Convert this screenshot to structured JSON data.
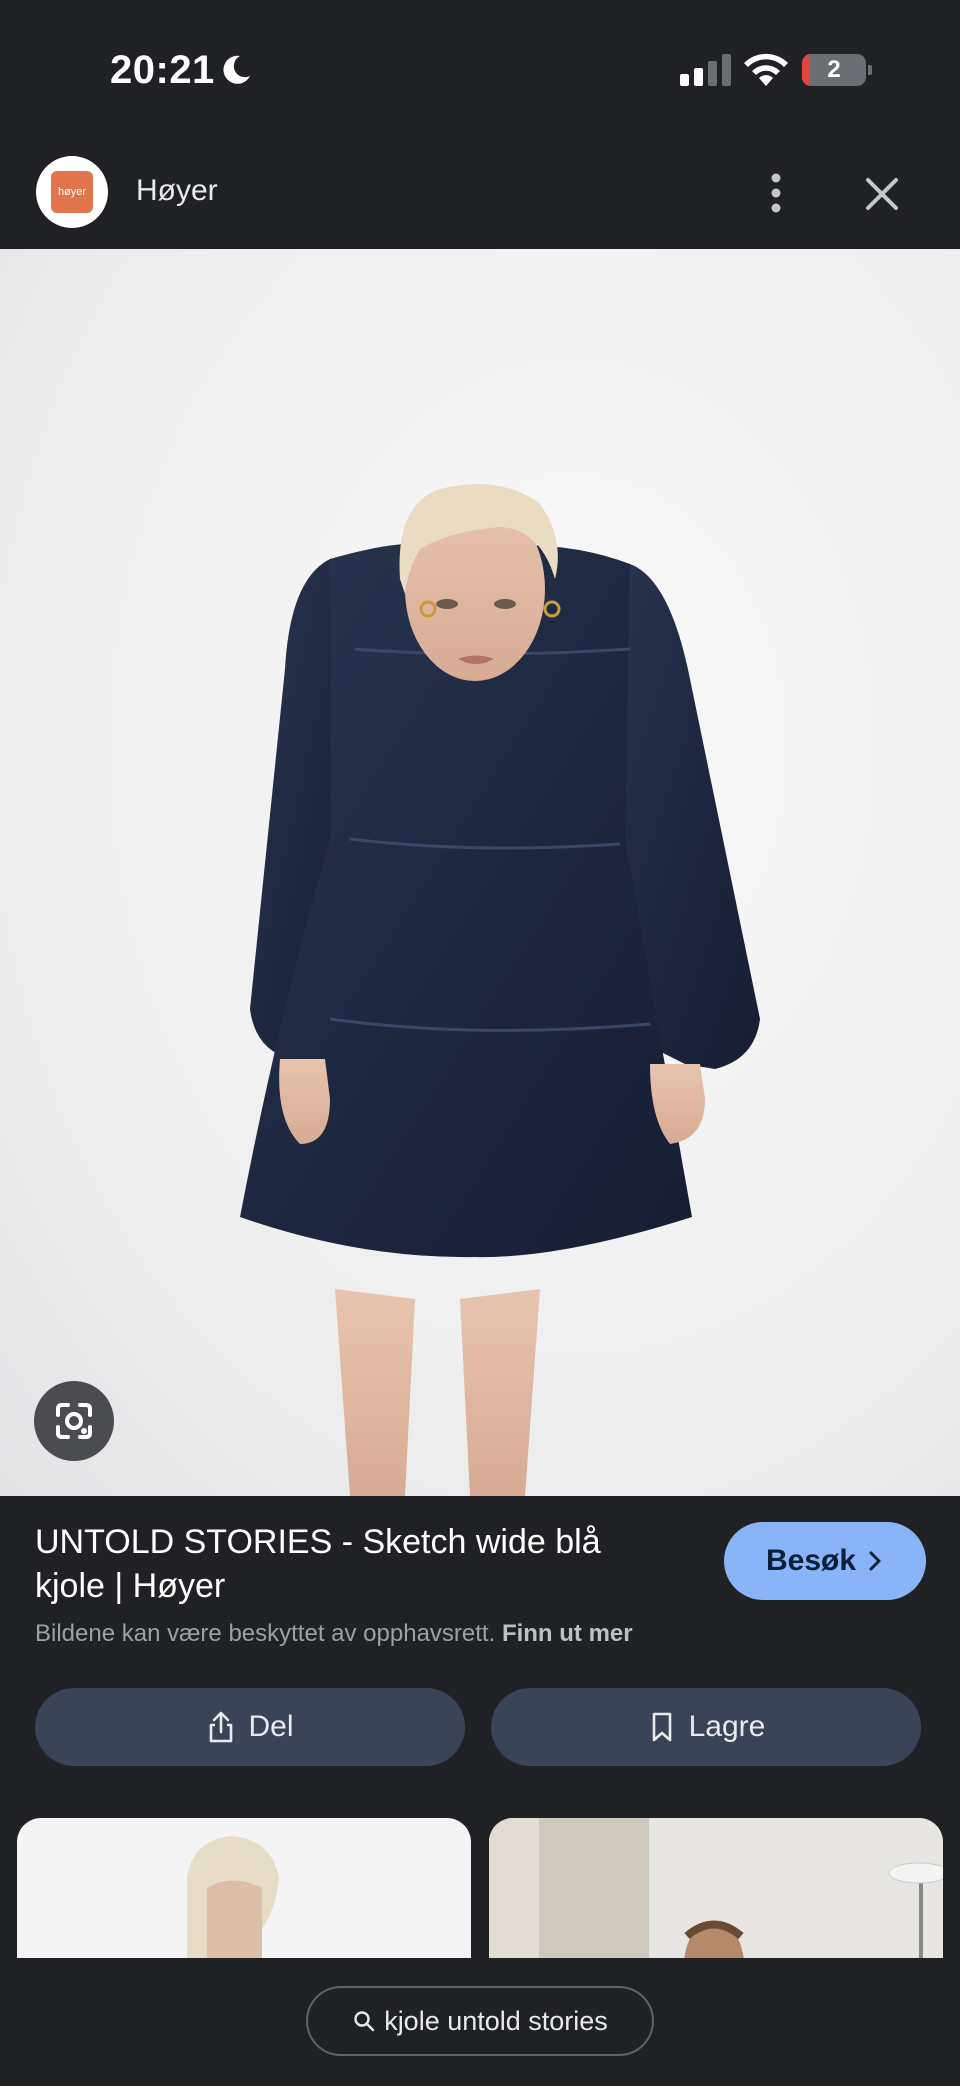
{
  "status_bar": {
    "time": "20:21",
    "battery_level": "2",
    "battery_fraction": 0.12
  },
  "site": {
    "logo_text": "høyer",
    "name": "Høyer"
  },
  "result": {
    "title": "UNTOLD STORIES - Sketch wide blå kjole | Høyer",
    "copyright_notice": "Bildene kan være beskyttet av opphavsrett.",
    "learn_more": "Finn ut mer",
    "visit_label": "Besøk"
  },
  "actions": {
    "share_label": "Del",
    "save_label": "Lagre"
  },
  "search": {
    "query": "kjole untold stories"
  },
  "icons": {
    "lens": "google-lens-icon",
    "share": "share-icon",
    "save": "bookmark-icon",
    "search": "search-icon",
    "more": "more-vert-icon",
    "close": "close-icon"
  },
  "colors": {
    "accent": "#8ab4f8",
    "surface": "#202124",
    "button": "#394457",
    "brand": "#e0744b"
  }
}
